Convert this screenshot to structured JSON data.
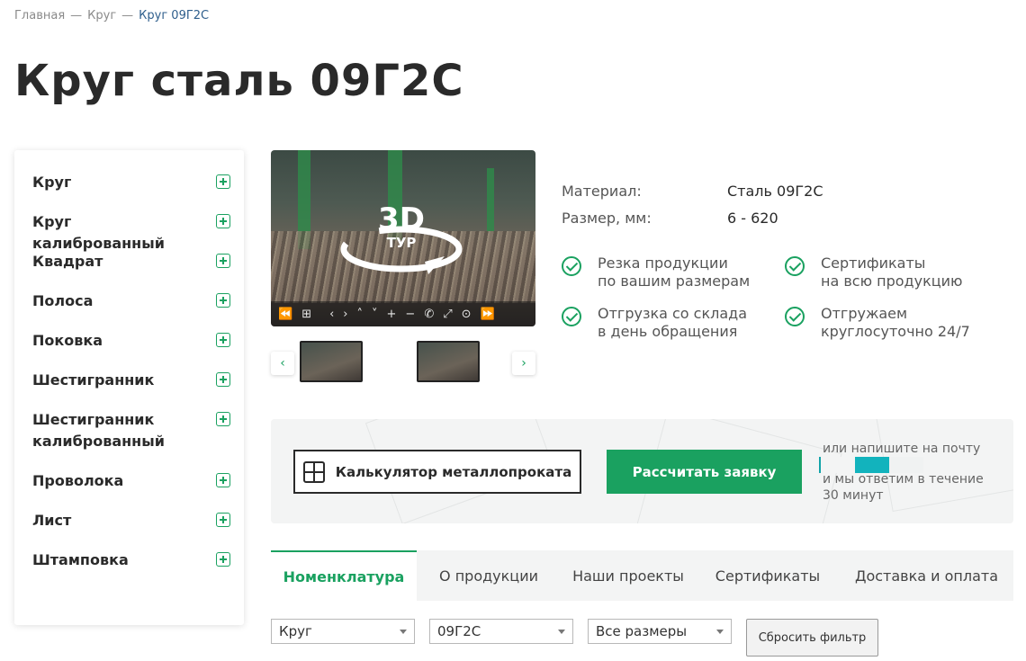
{
  "breadcrumb": {
    "home": "Главная",
    "sep": "—",
    "parent": "Круг",
    "current": "Круг 09Г2С"
  },
  "page_title": "Круг сталь 09Г2С",
  "sidebar": {
    "items": [
      {
        "label": "Круг"
      },
      {
        "label": "Круг калиброванный"
      },
      {
        "label": "Квадрат"
      },
      {
        "label": "Полоса"
      },
      {
        "label": "Поковка"
      },
      {
        "label": "Шестигранник"
      },
      {
        "label": "Шестигранник калиброванный"
      },
      {
        "label": "Проволока"
      },
      {
        "label": "Лист"
      },
      {
        "label": "Штамповка"
      }
    ]
  },
  "gallery": {
    "tour_text": "3D",
    "tour_sub": "ТУР",
    "controls": [
      "⏪",
      "⊞",
      "‹",
      "›",
      "˄",
      "˅",
      "+",
      "−",
      "✆",
      "⤢",
      "⊙",
      "⏩"
    ],
    "prev": "‹",
    "next": "›"
  },
  "specs": {
    "material_label": "Материал:",
    "material_value": "Сталь 09Г2С",
    "size_label": "Размер, мм:",
    "size_value": "6 - 620"
  },
  "features": [
    {
      "line1": "Резка продукции",
      "line2": "по вашим размерам"
    },
    {
      "line1": "Сертификаты",
      "line2": "на всю продукцию"
    },
    {
      "line1": "Отгрузка со склада",
      "line2": "в день обращения"
    },
    {
      "line1": "Отгружаем",
      "line2": "круглосуточно 24/7"
    }
  ],
  "actions": {
    "calc_label": "Калькулятор металлопроката",
    "request_label": "Рассчитать заявку",
    "mail_top": "или напишите на почту",
    "mail_bottom": "и мы ответим в течение 30 минут"
  },
  "tabs": [
    {
      "label": "Номенклатура",
      "active": true
    },
    {
      "label": "О продукции"
    },
    {
      "label": "Наши проекты"
    },
    {
      "label": "Сертификаты"
    },
    {
      "label": "Доставка и оплата"
    }
  ],
  "filters": {
    "type": "Круг",
    "grade": "09Г2С",
    "size": "Все размеры",
    "reset_label": "Сбросить фильтр"
  },
  "colors": {
    "accent": "#1aa160",
    "link": "#2e5e8c"
  }
}
